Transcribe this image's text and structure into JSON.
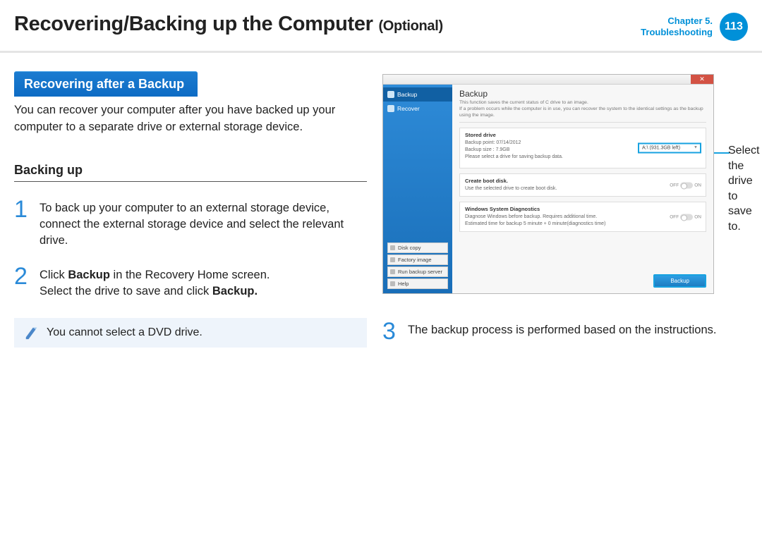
{
  "header": {
    "title_main": "Recovering/Backing up the Computer",
    "title_suffix": "(Optional)",
    "chapter_line1": "Chapter 5.",
    "chapter_line2": "Troubleshooting",
    "page_number": "113"
  },
  "section": {
    "banner": "Recovering after a Backup",
    "intro": "You can recover your computer after you have backed up your computer to a separate drive or external storage device.",
    "subheading": "Backing up"
  },
  "steps": {
    "s1_num": "1",
    "s1_text": "To back up your computer to an external storage device, connect the external storage device and select the relevant drive.",
    "s2_num": "2",
    "s2_text_a": "Click ",
    "s2_bold_a": "Backup",
    "s2_text_b": " in the Recovery Home screen.\nSelect the drive to save and click ",
    "s2_bold_b": "Backup.",
    "s3_num": "3",
    "s3_text": "The backup process is performed based on the instructions."
  },
  "note": {
    "text": "You cannot select a DVD drive."
  },
  "callout": {
    "text": "Select the drive to save to."
  },
  "screenshot": {
    "sidebar": {
      "item1": "Backup",
      "item2": "Recover",
      "btn1": "Disk copy",
      "btn2": "Factory image",
      "btn3": "Run backup server",
      "btn4": "Help"
    },
    "main_title": "Backup",
    "main_desc": "This function saves the current status of C drive to an image.\nIf a problem occurs while the computer is in use, you can recover the system to the identical settings as the backup using the image.",
    "panel1_title": "Stored drive",
    "panel1_line1": "Backup point: 07/14/2012",
    "panel1_line2": "Backup size : 7.9GB",
    "panel1_line3": "Please select a drive for saving backup data.",
    "dropdown_value": "A:\\ (931.3GB left)",
    "panel2_title": "Create boot disk.",
    "panel2_line": "Use the selected drive to create boot disk.",
    "panel3_title": "Windows System Diagnostics",
    "panel3_line": "Diagnose Windows before backup. Requires additional time.\nEstimated time for backup 5 minute + 0 minute(diagnostics time)",
    "toggle_off": "OFF",
    "toggle_on": "ON",
    "backup_button": "Backup"
  }
}
